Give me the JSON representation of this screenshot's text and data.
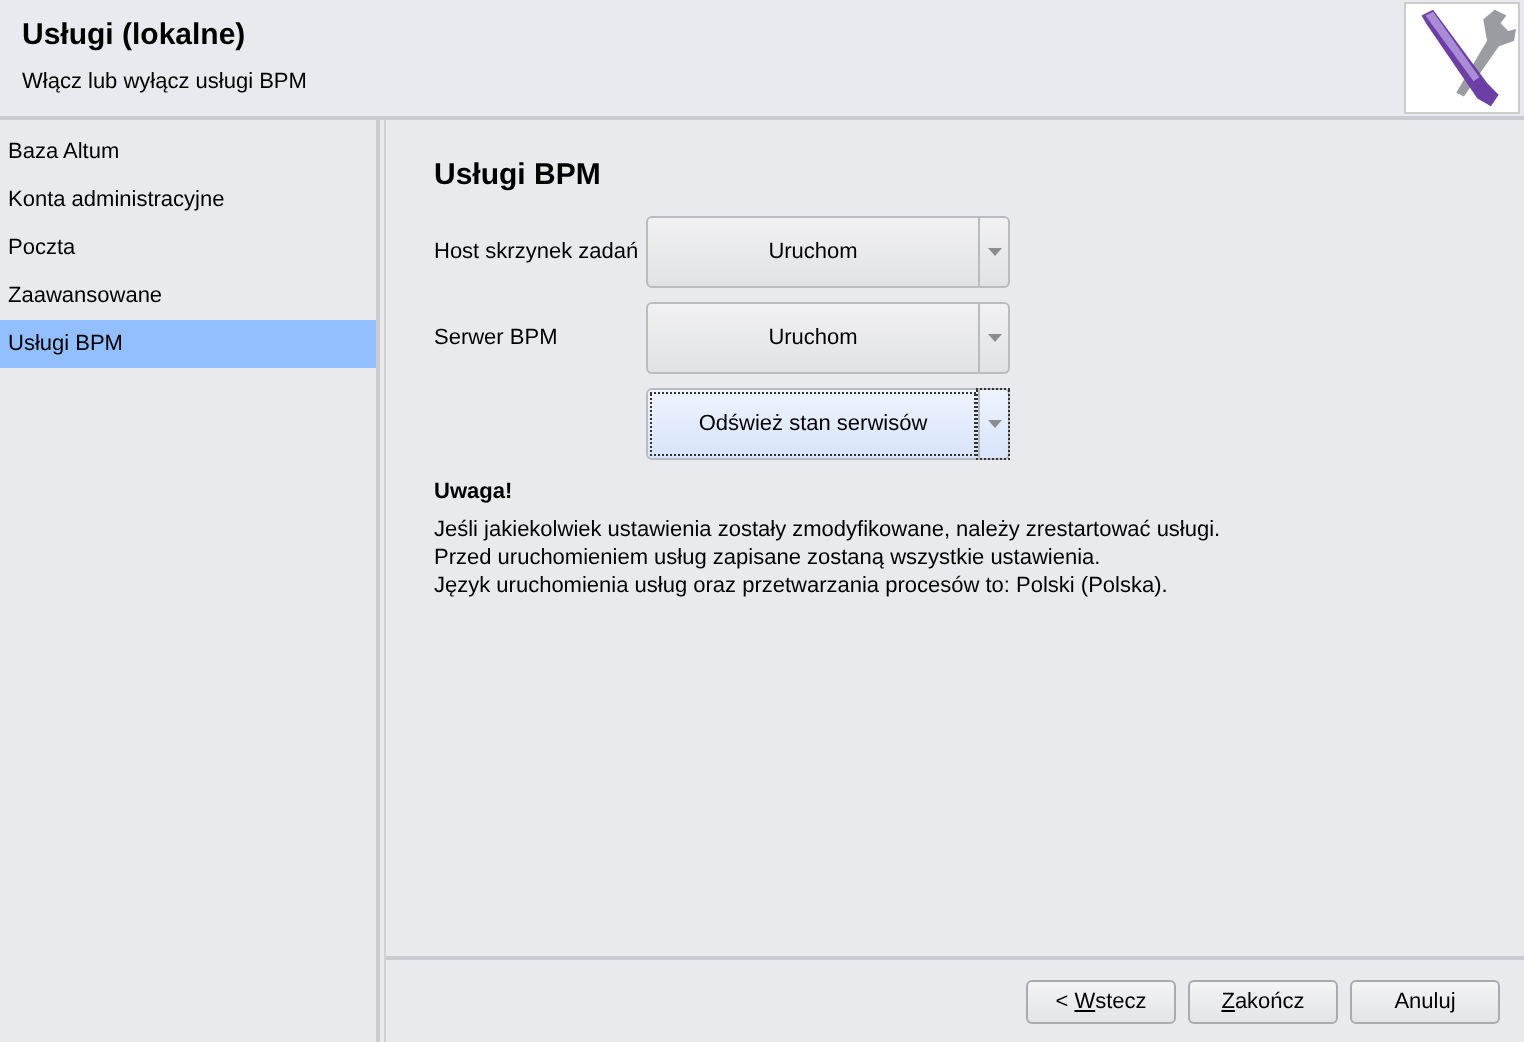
{
  "header": {
    "title": "Usługi (lokalne)",
    "subtitle": "Włącz lub wyłącz usługi BPM"
  },
  "sidebar": {
    "items": [
      {
        "label": "Baza Altum",
        "selected": false
      },
      {
        "label": "Konta administracyjne",
        "selected": false
      },
      {
        "label": "Poczta",
        "selected": false
      },
      {
        "label": "Zaawansowane",
        "selected": false
      },
      {
        "label": "Usługi BPM",
        "selected": true
      }
    ]
  },
  "panel": {
    "heading": "Usługi BPM",
    "rows": [
      {
        "label": "Host skrzynek zadań",
        "button": "Uruchom",
        "focused": false
      },
      {
        "label": "Serwer BPM",
        "button": "Uruchom",
        "focused": false
      },
      {
        "button": "Odśwież stan serwisów",
        "focused": true
      }
    ],
    "note_title": "Uwaga!",
    "note_lines": [
      "Jeśli jakiekolwiek ustawienia zostały zmodyfikowane, należy zrestartować usługi.",
      "Przed uruchomieniem usług zapisane zostaną wszystkie ustawienia.",
      "Język uruchomienia usług oraz przetwarzania procesów to: Polski (Polska)."
    ]
  },
  "footer": {
    "buttons": [
      {
        "before": "< ",
        "accelerator": "W",
        "after": "stecz"
      },
      {
        "accelerator": "Z",
        "after": "akończ"
      },
      {
        "before": "Anuluj"
      }
    ]
  }
}
